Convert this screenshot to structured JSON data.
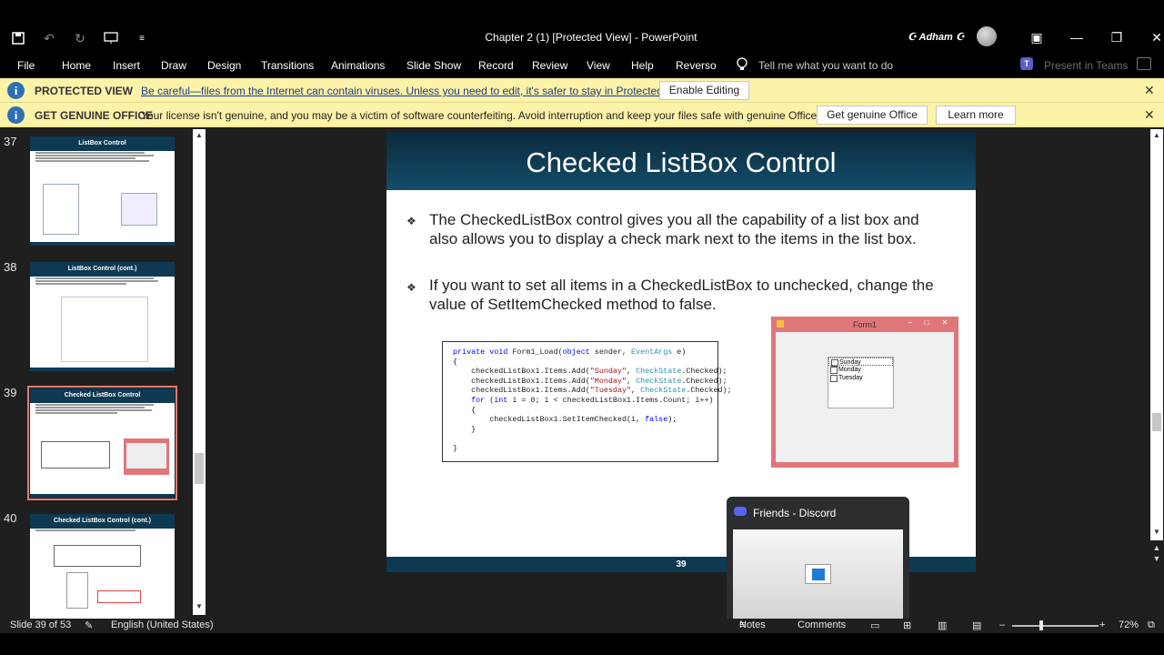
{
  "window": {
    "title": "Chapter 2 (1) [Protected View]  -  PowerPoint",
    "user": "☪ Adham ☪",
    "minimize": "—",
    "restore": "❐",
    "close": "✕",
    "ribbon_display": "▣"
  },
  "ribbon": {
    "tabs": [
      "File",
      "Home",
      "Insert",
      "Draw",
      "Design",
      "Transitions",
      "Animations",
      "Slide Show",
      "Record",
      "Review",
      "View",
      "Help",
      "Reverso"
    ],
    "tell_me": "Tell me what you want to do",
    "present_in_teams": "Present in Teams"
  },
  "protected_bar": {
    "label": "PROTECTED VIEW",
    "message": "Be careful—files from the Internet can contain viruses. Unless you need to edit, it's safer to stay in Protected View.",
    "button": "Enable Editing"
  },
  "genuine_bar": {
    "label": "GET GENUINE OFFICE",
    "message": "Your license isn't genuine, and you may be a victim of software counterfeiting. Avoid interruption and keep your files safe with genuine Office today.",
    "button_primary": "Get genuine Office",
    "button_secondary": "Learn more"
  },
  "thumbnails": [
    {
      "number": "37",
      "title": "ListBox Control"
    },
    {
      "number": "38",
      "title": "ListBox Control (cont.)"
    },
    {
      "number": "39",
      "title": "Checked ListBox Control"
    },
    {
      "number": "40",
      "title": "Checked ListBox Control (cont.)"
    }
  ],
  "slide": {
    "title": "Checked ListBox Control",
    "bullet1": "The CheckedListBox control gives you all the capability of a list box and also allows you to display a check mark next to the items in the list box.",
    "bullet2": "If you want to set all items in a CheckedListBox to unchecked, change the value of SetItemChecked method to false.",
    "bullet_symbol": "❖",
    "form_title": "Form1",
    "list_items": [
      "Sunday",
      "Monday",
      "Tuesday"
    ],
    "slide_number": "39"
  },
  "discord": {
    "title": "Friends - Discord"
  },
  "status": {
    "slide_info": "Slide 39 of 53",
    "language": "English (United States)",
    "notes": "Notes",
    "comments": "Comments",
    "zoom": "72%"
  }
}
